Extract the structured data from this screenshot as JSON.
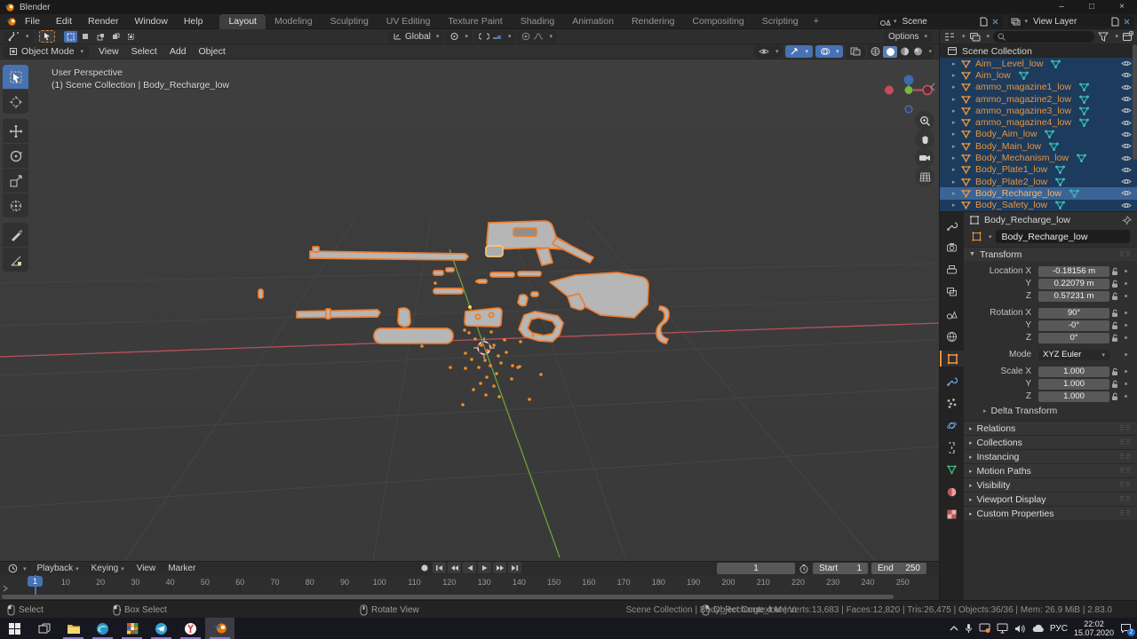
{
  "window": {
    "title": "Blender",
    "minimize": "–",
    "maximize": "□",
    "close": "×"
  },
  "topbar": {
    "menus": [
      "File",
      "Edit",
      "Render",
      "Window",
      "Help"
    ],
    "tabs": [
      "Layout",
      "Modeling",
      "Sculpting",
      "UV Editing",
      "Texture Paint",
      "Shading",
      "Animation",
      "Rendering",
      "Compositing",
      "Scripting"
    ],
    "active_tab": "Layout",
    "add_tab": "+",
    "scene_label": "Scene",
    "view_layer_label": "View Layer"
  },
  "tool_settings": {
    "orientation": "Global",
    "options": "Options"
  },
  "viewport_header": {
    "mode": "Object Mode",
    "menus": [
      "View",
      "Select",
      "Add",
      "Object"
    ]
  },
  "viewport_overlay": {
    "line1": "User Perspective",
    "line2": "(1) Scene Collection | Body_Recharge_low"
  },
  "outliner": {
    "root": "Scene Collection",
    "items": [
      {
        "name": "Aim__Level_low",
        "active": false
      },
      {
        "name": "Aim_low",
        "active": false
      },
      {
        "name": "ammo_magazine1_low",
        "active": false
      },
      {
        "name": "ammo_magazine2_low",
        "active": false
      },
      {
        "name": "ammo_magazine3_low",
        "active": false
      },
      {
        "name": "ammo_magazine4_low",
        "active": false
      },
      {
        "name": "Body_Aim_low",
        "active": false
      },
      {
        "name": "Body_Main_low",
        "active": false
      },
      {
        "name": "Body_Mechanism_low",
        "active": false
      },
      {
        "name": "Body_Plate1_low",
        "active": false
      },
      {
        "name": "Body_Plate2_low",
        "active": false
      },
      {
        "name": "Body_Recharge_low",
        "active": true
      },
      {
        "name": "Body_Safety_low",
        "active": false
      }
    ]
  },
  "properties": {
    "breadcrumb": "Body_Recharge_low",
    "name_field": "Body_Recharge_low",
    "transform_title": "Transform",
    "rows": {
      "location_label": "Location X",
      "location_x": "-0.18156 m",
      "location_y": "0.22079 m",
      "location_z": "0.57231 m",
      "rotation_label": "Rotation X",
      "rotation_x": "90°",
      "rotation_y": "-0°",
      "rotation_z": "0°",
      "mode_label": "Mode",
      "mode_value": "XYZ Euler",
      "scale_label": "Scale X",
      "scale_x": "1.000",
      "scale_y": "1.000",
      "scale_z": "1.000",
      "y_label": "Y",
      "z_label": "Z"
    },
    "delta_transform": "Delta Transform",
    "panels": [
      "Relations",
      "Collections",
      "Instancing",
      "Motion Paths",
      "Visibility",
      "Viewport Display",
      "Custom Properties"
    ]
  },
  "timeline": {
    "menus": [
      "Playback",
      "Keying",
      "View",
      "Marker"
    ],
    "current_frame": "1",
    "start_label": "Start",
    "start_value": "1",
    "end_label": "End",
    "end_value": "250",
    "ruler_ticks": [
      10,
      20,
      30,
      40,
      50,
      60,
      70,
      80,
      90,
      100,
      110,
      120,
      130,
      140,
      150,
      160,
      170,
      180,
      190,
      200,
      210,
      220,
      230,
      240,
      250
    ]
  },
  "statusbar": {
    "hints": [
      "Select",
      "Box Select",
      "Rotate View",
      "Object Context Menu"
    ],
    "stats": "Scene Collection | Body_Recharge_low | Verts:13,683 | Faces:12,820 | Tris:26,475 | Objects:36/36 | Mem: 26.9 MiB | 2.83.0"
  },
  "taskbar": {
    "lang": "РУС",
    "time": "22:02",
    "date": "15.07.2020",
    "notification_count": "2"
  },
  "colors": {
    "accent": "#4772b3",
    "blender_orange": "#ea7600",
    "object_orange": "#e9953f",
    "selection_blue": "#1d3b5c",
    "active_row_blue": "#3b6496",
    "mesh_teal": "#39b8b8",
    "outline_orange": "#ee7e30",
    "viewport_bg": "#3c3c3c"
  }
}
